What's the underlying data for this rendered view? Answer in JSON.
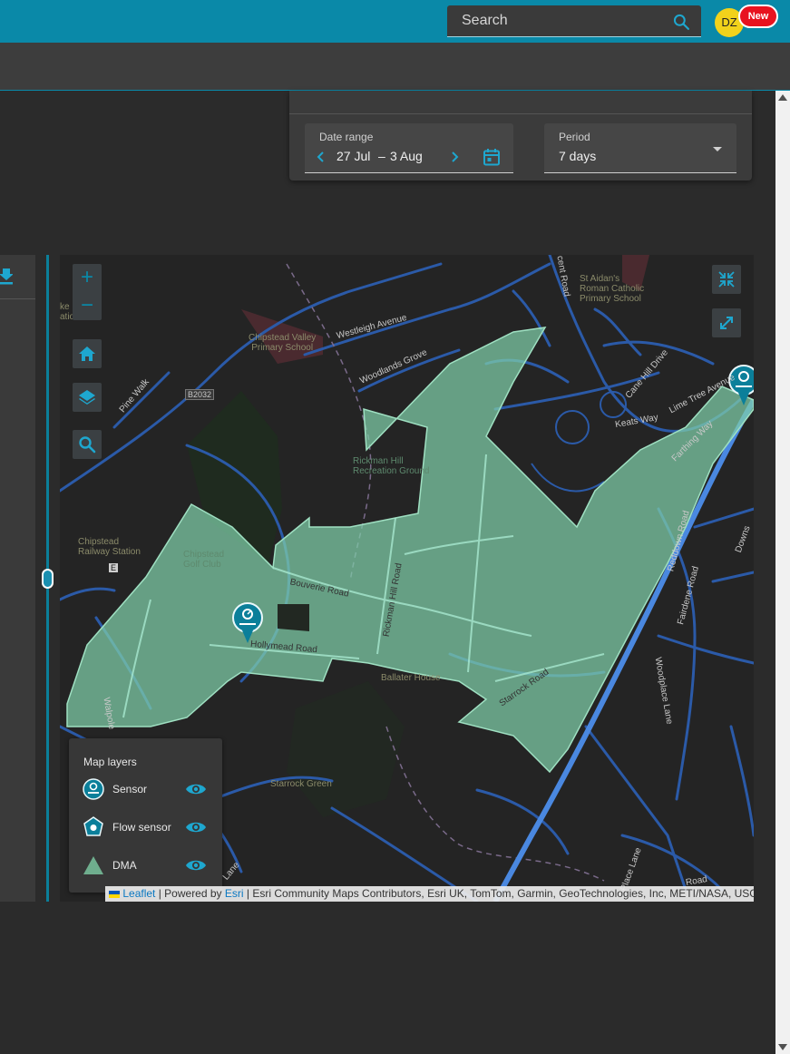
{
  "header": {
    "search_placeholder": "Search",
    "search_icon": "search-icon",
    "avatar_initials": "DZ",
    "new_badge": "New",
    "accent": "#0a89a8"
  },
  "filters": {
    "date_range": {
      "label": "Date range",
      "start": "27 Jul",
      "separator": "–",
      "end": "3 Aug"
    },
    "period": {
      "label": "Period",
      "value": "7 days"
    }
  },
  "map": {
    "controls": {
      "zoom_in": "+",
      "zoom_out": "−"
    },
    "legend": {
      "title": "Map layers",
      "items": [
        {
          "name": "Sensor",
          "icon": "sensor-icon"
        },
        {
          "name": "Flow sensor",
          "icon": "flow-sensor-icon"
        },
        {
          "name": "DMA",
          "icon": "dma-triangle-icon"
        }
      ]
    },
    "labels": {
      "chipstead_valley_school": "Chipstead Valley\nPrimary School",
      "st_aidans": "St Aidan's\nRoman Catholic\nPrimary School",
      "westleigh_avenue": "Westleigh Avenue",
      "woodlands_grove": "Woodlands Grove",
      "pine_walk": "Pine Walk",
      "b2032": "B2032",
      "keats_way": "Keats Way",
      "cane_hill_drive": "Cane Hill Drive",
      "lime_tree_avenue": "Lime Tree Avenue",
      "farthing_way": "Farthing Way",
      "rickman_hill_ground": "Rickman Hill\nRecreation Ground",
      "chipstead_railway_station": "Chipstead\nRailway Station",
      "chipstead_golf_club": "Chipstead\nGolf Club",
      "bouverie_road": "Bouverie Road",
      "rickman_hill_road": "Rickman Hill Road",
      "hollymead_road": "Hollymead Road",
      "ballater_house": "Ballater House",
      "starrock_road": "Starrock Road",
      "reddown_road": "Reddown Road",
      "fairdene_road": "Fairdene Road",
      "woodplace_lane": "Woodplace Lane",
      "starrock_green": "Starrock Green",
      "walpole": "Walpole",
      "downs": "Downs",
      "place_lane": "Place Lane",
      "lane": "Lane",
      "road": "Road",
      "cent_road": "cent Road",
      "ke": "ke",
      "ati_und": "atio   und",
      "rail_e": "E"
    },
    "attribution": {
      "leaflet": "Leaflet",
      "powered_by": "Powered by",
      "esri": "Esri",
      "sources": "Esri Community Maps Contributors, Esri UK, TomTom, Garmin, GeoTechnologies, Inc, METI/NASA, USGS"
    }
  }
}
